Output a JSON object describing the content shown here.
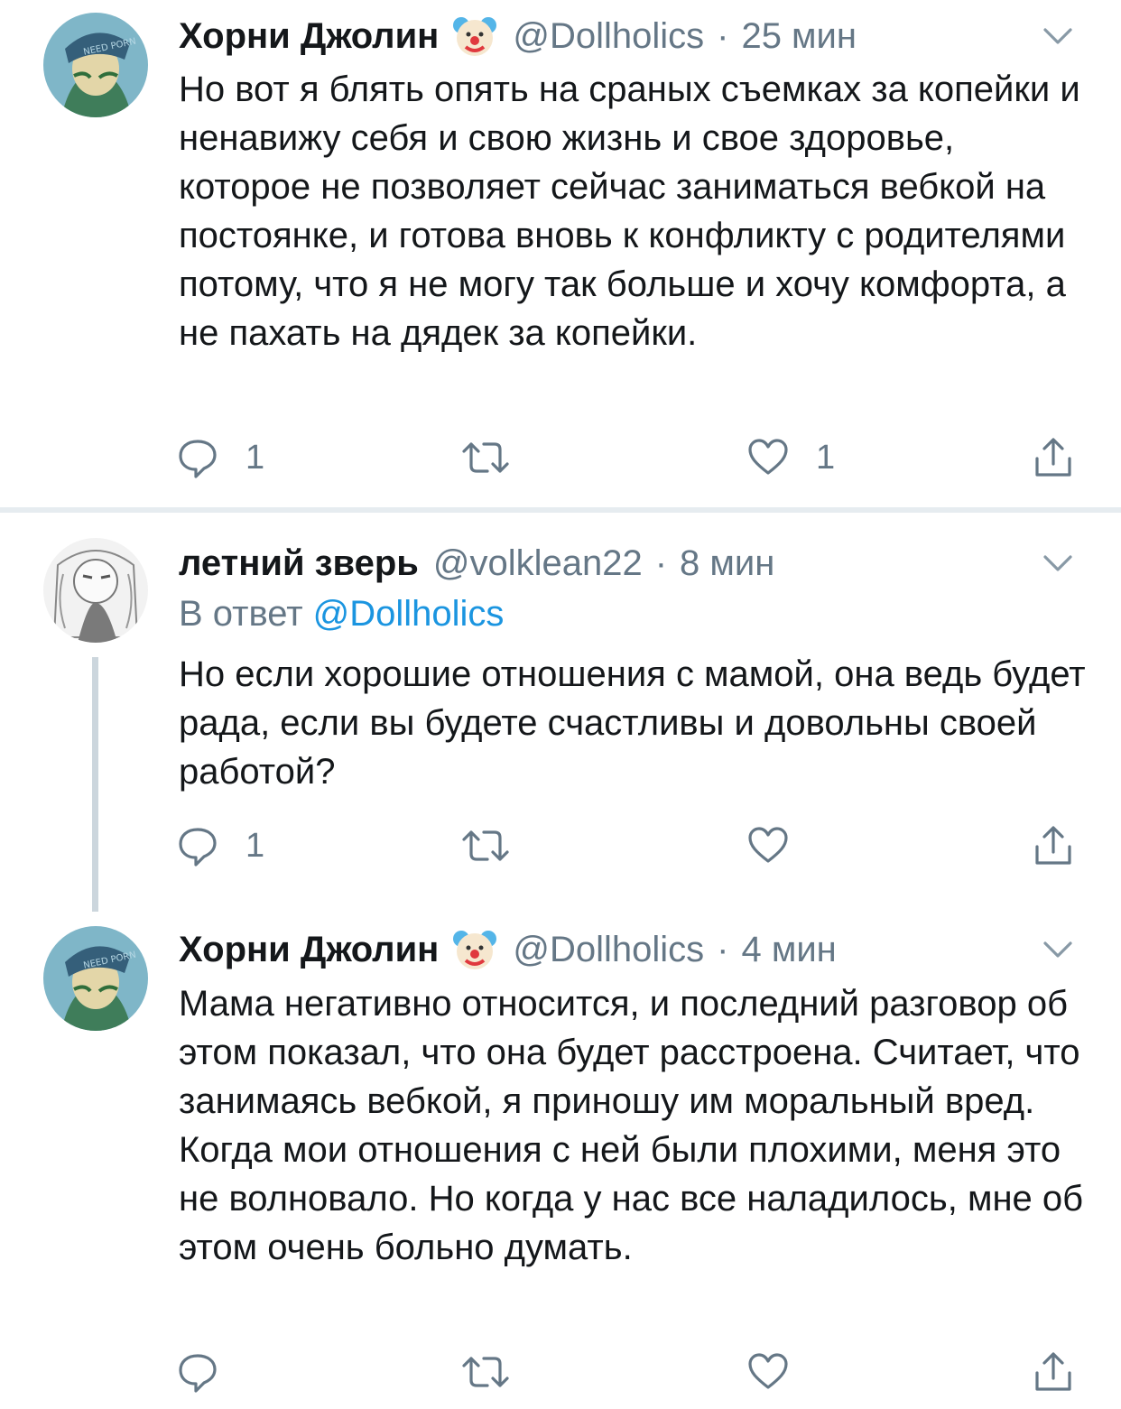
{
  "tweets": [
    {
      "name": "Хорни Джолин",
      "handle": "@Dollholics",
      "separator": "·",
      "time": "25 мин",
      "body": "Но вот я блять опять на сраных съемках за копейки и ненавижу себя и свою жизнь и свое здоровье, которое не позволяет сейчас заниматься вебкой на постоянке, и готова вновь к конфликту с родителями потому, что я не могу так больше и хочу комфорта,  а не пахать на дядек за копейки.",
      "reply_count": "1",
      "retweet_count": "",
      "like_count": "1",
      "avatar_text": "NEED PORN"
    },
    {
      "name": "летний зверь",
      "handle": "@volklean22",
      "separator": "·",
      "time": "8 мин",
      "reply_prefix": "В ответ",
      "reply_mention": "@Dollholics",
      "body": "Но если хорошие отношения с мамой, она ведь будет рада, если вы будете счастливы и довольны своей работой?",
      "reply_count": "1",
      "retweet_count": "",
      "like_count": ""
    },
    {
      "name": "Хорни Джолин",
      "handle": "@Dollholics",
      "separator": "·",
      "time": "4 мин",
      "body": "Мама негативно относится, и последний разговор об этом показал, что она будет расстроена. Считает, что занимаясь вебкой, я приношу им моральный вред.\nКогда мои отношения с ней были плохими, меня это не волновало. Но когда у нас все наладилось, мне об этом очень больно думать.",
      "reply_count": "",
      "retweet_count": "",
      "like_count": "",
      "avatar_text": "NEED PORN"
    }
  ],
  "icons": {
    "reply": "reply-bubble-icon",
    "retweet": "retweet-icon",
    "like": "heart-icon",
    "share": "share-icon",
    "menu": "chevron-down-icon",
    "badge": "clown-face-emoji"
  },
  "colors": {
    "text": "#14171a",
    "secondary": "#657786",
    "link": "#1b95e0",
    "divider": "#e6ecf0",
    "thread_line": "#ccd6dd"
  }
}
